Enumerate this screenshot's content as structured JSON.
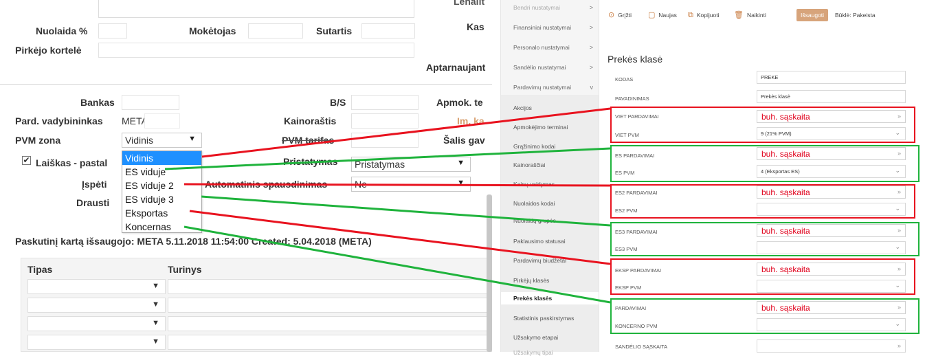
{
  "left_form": {
    "truncated_label_top": "Lenalit",
    "nuolaida_label": "Nuolaida %",
    "moketojas_label": "Mokėtojas",
    "sutartis_label": "Sutartis",
    "kas_label": "Kas",
    "pirkejo_kortele_label": "Pirkėjo kortelė",
    "aptarnaujant_label": "Aptarnaujant",
    "bankas_label": "Bankas",
    "bs_label": "B/S",
    "apmok_label": "Apmok. te",
    "pard_vad_label": "Pard. vadybininkas",
    "pard_vad_value": "META",
    "kainorastis_label": "Kainoraštis",
    "im_label": "Im. ka",
    "pvm_zona_label": "PVM zona",
    "pvm_zona_value": "Vidinis",
    "pvm_tarifas_label": "PVM tarifas",
    "salis_label": "Šalis gav",
    "laiskas_label": "Laiškas - pastal",
    "pristatymas_label": "Pristatymas",
    "pristatymas_value": "Pristatymas",
    "ispeti_label": "Įspėti",
    "automatinis_label": "Automatinis spausdinimas",
    "automatinis_value": "Ne",
    "drausti_label": "Drausti",
    "dropdown_options": [
      "Vidinis",
      "ES viduje",
      "ES viduje 2",
      "ES viduje 3",
      "Eksportas",
      "Koncernas"
    ],
    "saved_text": "Paskutinį kartą išsaugojo:  META 5.11.2018 11:54:00   Created: 5.04.2018 (META)",
    "table_header_tipas": "Tipas",
    "table_header_turinys": "Turinys"
  },
  "nav": {
    "items": [
      {
        "label": "Bendri nustatymai",
        "chev": ">"
      },
      {
        "label": "Finansiniai nustatymai",
        "chev": ">"
      },
      {
        "label": "Personalo nustatymai",
        "chev": ">"
      },
      {
        "label": "Sandėlio nustatymai",
        "chev": ">"
      },
      {
        "label": "Pardavimų nustatymai",
        "chev": "v"
      }
    ],
    "subitems": [
      "Akcijos",
      "Apmokėjimo terminai",
      "Grąžinimo kodai",
      "Kainoraščiai",
      "Kainų valdymas",
      "Nuolaidos kodai",
      "Nuolaidų grupės",
      "Paklausimo statusai",
      "Pardavimų biudžetai",
      "Pirkėjų klasės",
      "Prekės klasės",
      "Statistinis paskirstymas",
      "Užsakymo etapai",
      "Užsakymų tipai"
    ],
    "active": "Prekės klasės"
  },
  "toolbar": {
    "grizti": "Grįžti",
    "naujas": "Naujas",
    "kopijuoti": "Kopijuoti",
    "naikinti": "Naikinti",
    "issaugoti": "Išsaugoti",
    "busena": "Būklė: Pakeista"
  },
  "right_panel": {
    "title": "Prekės klasė",
    "kodas_label": "KODAS",
    "kodas_value": "PREKE",
    "pavadinimas_label": "PAVADINIMAS",
    "pavadinimas_value": "Prekės klasė",
    "rows": [
      {
        "sales_label": "VIET PARDAVIMAI",
        "pvm_label": "VIET PVM",
        "pvm_value": "9 (21% PVM)"
      },
      {
        "sales_label": "ES PARDAVIMAI",
        "pvm_label": "ES PVM",
        "pvm_value": "4 (Eksportas ES)"
      },
      {
        "sales_label": "ES2 PARDAVIMAI",
        "pvm_label": "ES2 PVM",
        "pvm_value": ""
      },
      {
        "sales_label": "ES3 PARDAVIMAI",
        "pvm_label": "ES3 PVM",
        "pvm_value": ""
      },
      {
        "sales_label": "EKSP PARDAVIMAI",
        "pvm_label": "EKSP PVM",
        "pvm_value": ""
      },
      {
        "sales_label": "PARDAVIMAI",
        "pvm_label": "KONCERNO PVM",
        "pvm_value": ""
      }
    ],
    "account_text": "buh. sąskaita",
    "sandelio_label": "SANDĖLIO SĄSKAITA"
  },
  "colors": {
    "red": "#e8131f",
    "green": "#1fb33c",
    "highlight": "#1e90ff",
    "save_button": "#d7a47b"
  },
  "icons": {
    "back": "back-icon",
    "new": "new-doc-icon",
    "copy": "copy-icon",
    "delete": "trash-icon",
    "arrow": "chevron-down-icon"
  }
}
